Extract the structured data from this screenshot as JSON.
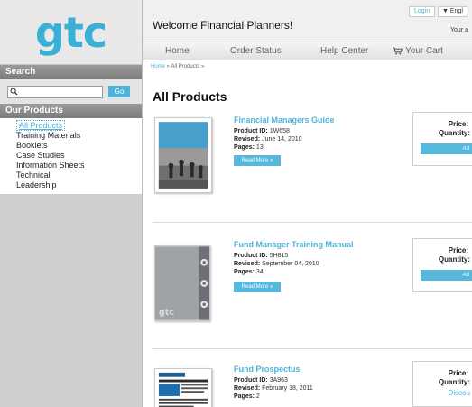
{
  "brand": {
    "logo_text": "gtc",
    "accent": "#4fb3d8"
  },
  "sidebar": {
    "search_heading": "Search",
    "search_placeholder": "",
    "go_label": "Go",
    "products_heading": "Our Products",
    "items": [
      {
        "label": "All Products",
        "active": true
      },
      {
        "label": "Training Materials"
      },
      {
        "label": "Booklets"
      },
      {
        "label": "Case Studies"
      },
      {
        "label": "Information Sheets"
      },
      {
        "label": "Technical"
      },
      {
        "label": "Leadership"
      }
    ]
  },
  "header": {
    "welcome": "Welcome Financial Planners!",
    "login_label": "Login",
    "language_label": "▼ Engl",
    "account_label": "Your a"
  },
  "nav": {
    "home": "Home",
    "order_status": "Order Status",
    "help_center": "Help Center",
    "cart": "Your Cart"
  },
  "breadcrumb": {
    "home": "Home",
    "separator": " » ",
    "current": "All Products »"
  },
  "main": {
    "title": "All Products"
  },
  "labels": {
    "product_id": "Product ID:",
    "revised": "Revised:",
    "pages": "Pages:",
    "read_more": "Read More »",
    "price": "Price:",
    "quantity": "Quantity:",
    "add": "Ad",
    "discount": "Discou"
  },
  "products": [
    {
      "title": "Financial Managers Guide",
      "id": "1W658",
      "revised": "June 14, 2010",
      "pages": "13"
    },
    {
      "title": "Fund Manager Training Manual",
      "id": "5H815",
      "revised": "September 04, 2010",
      "pages": "34"
    },
    {
      "title": "Fund Prospectus",
      "id": "3A963",
      "revised": "February 18, 2011",
      "pages": "2"
    }
  ]
}
